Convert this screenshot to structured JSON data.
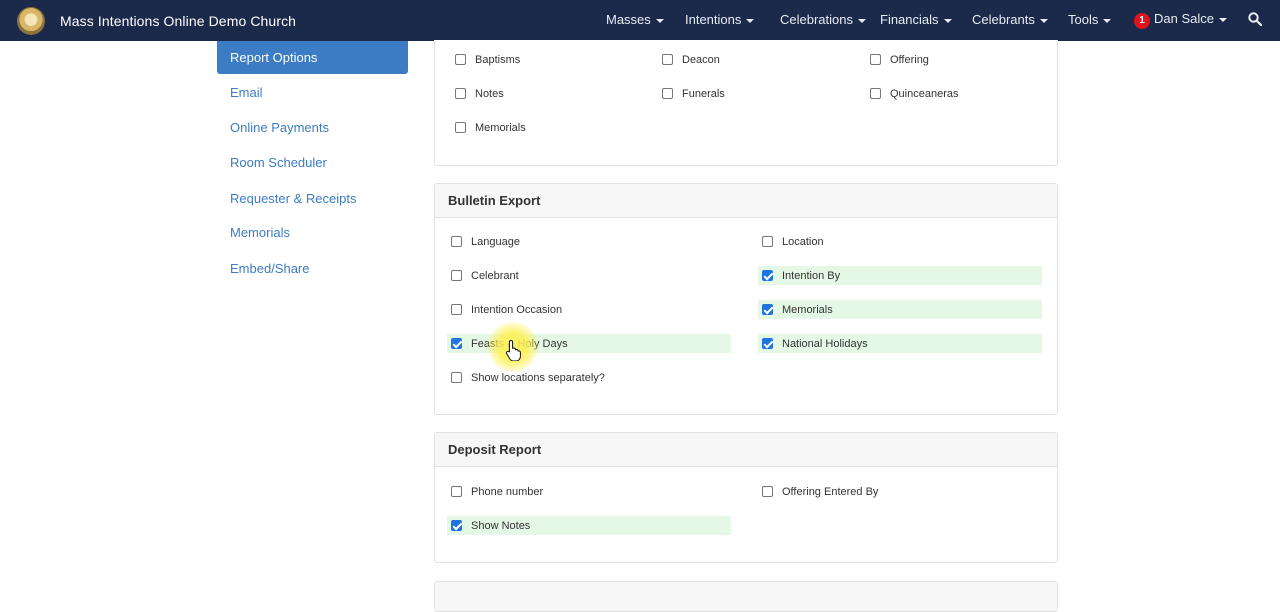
{
  "navbar": {
    "brand": "Mass Intentions Online Demo Church",
    "menus": [
      "Masses",
      "Intentions",
      "Celebrations",
      "Financials",
      "Celebrants",
      "Tools"
    ],
    "notification_count": "1",
    "user": "Dan Salce",
    "icons": {
      "logo": "church-logo-icon",
      "search": "search-icon",
      "dropdown": "caret-down-icon"
    }
  },
  "sidebar": {
    "active": "Report Options",
    "items": [
      "Email",
      "Online Payments",
      "Room Scheduler",
      "Requester & Receipts",
      "Memorials",
      "Embed/Share"
    ]
  },
  "top_section": {
    "options": [
      {
        "label": "Baptisms",
        "checked": false
      },
      {
        "label": "Deacon",
        "checked": false
      },
      {
        "label": "Offering",
        "checked": false
      },
      {
        "label": "Notes",
        "checked": false
      },
      {
        "label": "Funerals",
        "checked": false
      },
      {
        "label": "Quinceaneras",
        "checked": false
      },
      {
        "label": "Memorials",
        "checked": false
      }
    ]
  },
  "bulletin_export": {
    "title": "Bulletin Export",
    "options": [
      {
        "label": "Language",
        "checked": false
      },
      {
        "label": "Location",
        "checked": false
      },
      {
        "label": "Celebrant",
        "checked": false
      },
      {
        "label": "Intention By",
        "checked": true
      },
      {
        "label": "Intention Occasion",
        "checked": false
      },
      {
        "label": "Memorials",
        "checked": true
      },
      {
        "label": "Feasts & Holy Days",
        "checked": true
      },
      {
        "label": "National Holidays",
        "checked": true
      },
      {
        "label": "Show locations separately?",
        "checked": false
      }
    ]
  },
  "deposit_report": {
    "title": "Deposit Report",
    "options": [
      {
        "label": "Phone number",
        "checked": false
      },
      {
        "label": "Offering Entered By",
        "checked": false
      },
      {
        "label": "Show Notes",
        "checked": true
      }
    ]
  },
  "colors": {
    "navbar": "#1b2a4a",
    "accent": "#3c7cc4",
    "highlight": "#e5f8e5",
    "checkbox_on": "#1f74e0",
    "badge": "#e0141c"
  }
}
